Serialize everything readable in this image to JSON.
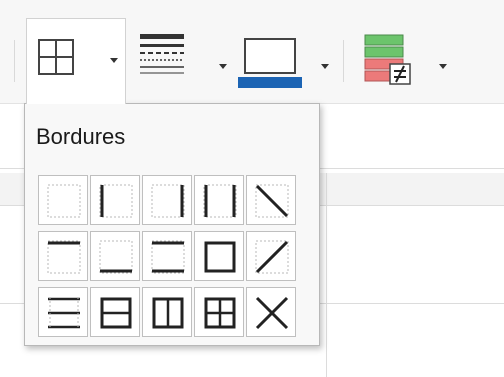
{
  "popup": {
    "title": "Bordures"
  },
  "toolbar": {
    "buttons": [
      {
        "name": "borders",
        "icon": "borders-icon"
      },
      {
        "name": "border-style",
        "icon": "border-style-icon"
      },
      {
        "name": "border-color",
        "icon": "border-color-icon",
        "color": "#1c64b4"
      },
      {
        "name": "conditional",
        "icon": "conditional-format-icon"
      }
    ]
  },
  "border_presets": [
    "no-borders",
    "left-border",
    "right-border",
    "left-right-borders",
    "diagonal-down-border",
    "top-border",
    "bottom-border",
    "top-bottom-borders",
    "outer-border",
    "diagonal-up-border",
    "horizontal-inner-borders",
    "outer-and-horizontal-borders",
    "outer-and-vertical-borders",
    "all-borders",
    "crossed-diagonal-borders"
  ],
  "colors": {
    "accent_blue": "#1c64b4",
    "conditional_green": "#6cc46c",
    "conditional_red": "#ec7a7a"
  }
}
